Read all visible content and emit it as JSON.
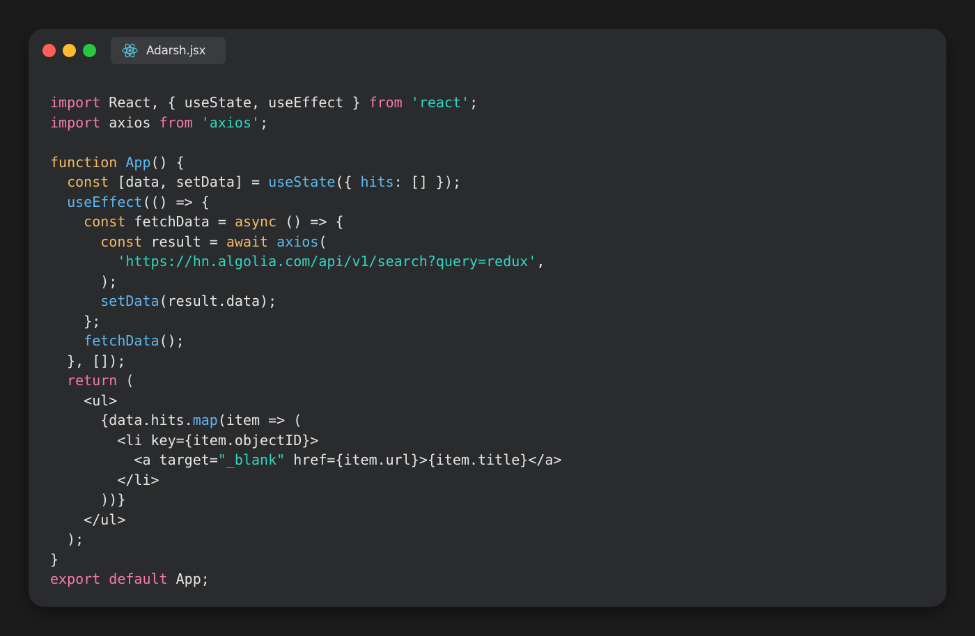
{
  "window": {
    "tab": {
      "label": "Adarsh.jsx",
      "icon": "react-icon"
    }
  },
  "colors": {
    "background": "#1c1c1c",
    "window": "#2a2b2d",
    "tab": "#3a3b3e",
    "close_dot": "#fe5f57",
    "minimize_dot": "#febc2e",
    "maximize_dot": "#28c840",
    "text": "#e6e6e6",
    "keyword_pink": "#f47ba6",
    "keyword_orange": "#f2b96a",
    "function_blue": "#5db8f0",
    "string_teal": "#30d6c2",
    "react_icon": "#58c4dc"
  },
  "code": {
    "lines": [
      [
        {
          "t": "import",
          "c": "kw"
        },
        {
          "t": " React, { useState, useEffect } ",
          "c": "pl"
        },
        {
          "t": "from",
          "c": "kw"
        },
        {
          "t": " ",
          "c": "pl"
        },
        {
          "t": "'react'",
          "c": "st"
        },
        {
          "t": ";",
          "c": "pl"
        }
      ],
      [
        {
          "t": "import",
          "c": "kw"
        },
        {
          "t": " axios ",
          "c": "pl"
        },
        {
          "t": "from",
          "c": "kw"
        },
        {
          "t": " ",
          "c": "pl"
        },
        {
          "t": "'axios'",
          "c": "st"
        },
        {
          "t": ";",
          "c": "pl"
        }
      ],
      [],
      [
        {
          "t": "function",
          "c": "ko"
        },
        {
          "t": " ",
          "c": "pl"
        },
        {
          "t": "App",
          "c": "fn"
        },
        {
          "t": "() {",
          "c": "pl"
        }
      ],
      [
        {
          "t": "  ",
          "c": "pl"
        },
        {
          "t": "const",
          "c": "ko"
        },
        {
          "t": " [data, setData] = ",
          "c": "pl"
        },
        {
          "t": "useState",
          "c": "fn"
        },
        {
          "t": "({ ",
          "c": "pl"
        },
        {
          "t": "hits",
          "c": "fn"
        },
        {
          "t": ": [] });",
          "c": "pl"
        }
      ],
      [
        {
          "t": "  ",
          "c": "pl"
        },
        {
          "t": "useEffect",
          "c": "fn"
        },
        {
          "t": "(() => {",
          "c": "pl"
        }
      ],
      [
        {
          "t": "    ",
          "c": "pl"
        },
        {
          "t": "const",
          "c": "ko"
        },
        {
          "t": " fetchData = ",
          "c": "pl"
        },
        {
          "t": "async",
          "c": "ko"
        },
        {
          "t": " () => {",
          "c": "pl"
        }
      ],
      [
        {
          "t": "      ",
          "c": "pl"
        },
        {
          "t": "const",
          "c": "ko"
        },
        {
          "t": " result = ",
          "c": "pl"
        },
        {
          "t": "await",
          "c": "ko"
        },
        {
          "t": " ",
          "c": "pl"
        },
        {
          "t": "axios",
          "c": "fn"
        },
        {
          "t": "(",
          "c": "pl"
        }
      ],
      [
        {
          "t": "        ",
          "c": "pl"
        },
        {
          "t": "'https://hn.algolia.com/api/v1/search?query=redux'",
          "c": "st"
        },
        {
          "t": ",",
          "c": "pl"
        }
      ],
      [
        {
          "t": "      );",
          "c": "pl"
        }
      ],
      [
        {
          "t": "      ",
          "c": "pl"
        },
        {
          "t": "setData",
          "c": "fn"
        },
        {
          "t": "(result.data);",
          "c": "pl"
        }
      ],
      [
        {
          "t": "    };",
          "c": "pl"
        }
      ],
      [
        {
          "t": "    ",
          "c": "pl"
        },
        {
          "t": "fetchData",
          "c": "fn"
        },
        {
          "t": "();",
          "c": "pl"
        }
      ],
      [
        {
          "t": "  }, []);",
          "c": "pl"
        }
      ],
      [
        {
          "t": "  ",
          "c": "pl"
        },
        {
          "t": "return",
          "c": "kw"
        },
        {
          "t": " (",
          "c": "pl"
        }
      ],
      [
        {
          "t": "    <ul>",
          "c": "pl"
        }
      ],
      [
        {
          "t": "      {data.hits.",
          "c": "pl"
        },
        {
          "t": "map",
          "c": "fn"
        },
        {
          "t": "(item => (",
          "c": "pl"
        }
      ],
      [
        {
          "t": "        <li key={item.objectID}>",
          "c": "pl"
        }
      ],
      [
        {
          "t": "          <a target=",
          "c": "pl"
        },
        {
          "t": "\"_blank\"",
          "c": "st"
        },
        {
          "t": " href={item.url}>{item.title}</a>",
          "c": "pl"
        }
      ],
      [
        {
          "t": "        </li>",
          "c": "pl"
        }
      ],
      [
        {
          "t": "      ))}",
          "c": "pl"
        }
      ],
      [
        {
          "t": "    </ul>",
          "c": "pl"
        }
      ],
      [
        {
          "t": "  );",
          "c": "pl"
        }
      ],
      [
        {
          "t": "}",
          "c": "pl"
        }
      ],
      [
        {
          "t": "export",
          "c": "kw"
        },
        {
          "t": " ",
          "c": "pl"
        },
        {
          "t": "default",
          "c": "kw"
        },
        {
          "t": " App;",
          "c": "pl"
        }
      ]
    ]
  }
}
